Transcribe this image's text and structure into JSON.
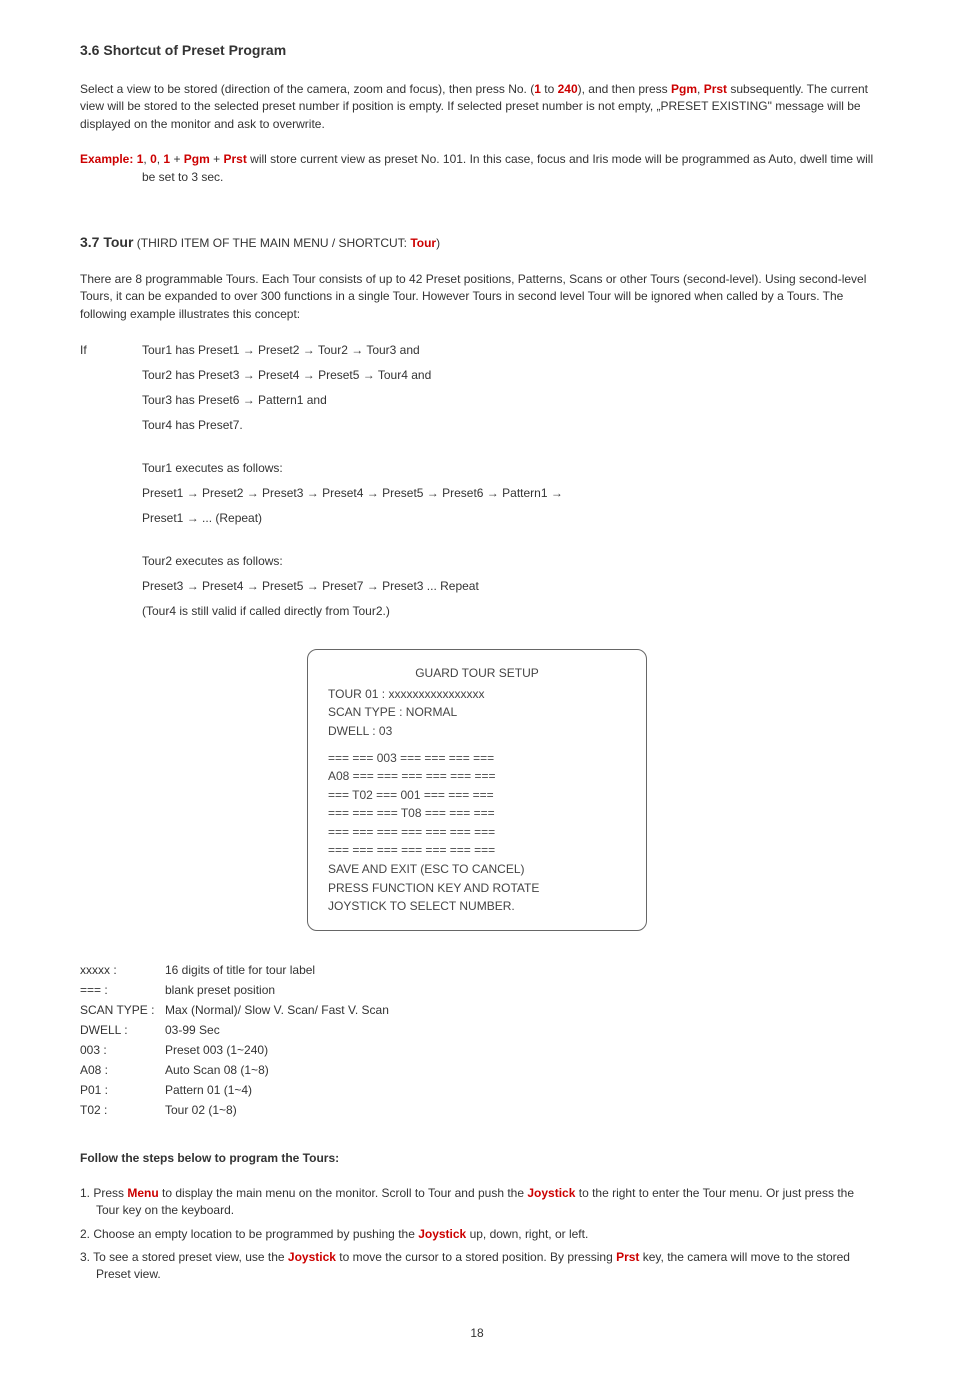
{
  "section36": {
    "heading": "3.6  Shortcut of Preset Program",
    "para1_a": "Select a view to be stored (direction of the camera, zoom and focus), then press No. (",
    "para1_b": " to ",
    "para1_c": "), and then press ",
    "para1_d": ", ",
    "para1_e": " subsequently. The current view will be stored to the selected preset number if position is empty. If selected preset number is not empty, „PRESET EXISTING\" message will be displayed on the monitor and ask to overwrite.",
    "no1": "1",
    "no240": "240",
    "pgm": "Pgm",
    "prst": "Prst",
    "example_label": "Example: ",
    "ex_1": "1",
    "ex_comma1": ", ",
    "ex_0": "0",
    "ex_comma2": ", ",
    "ex_1b": "1",
    "ex_plus1": " + ",
    "ex_pgm": "Pgm",
    "ex_plus2": " + ",
    "ex_prst": "Prst",
    "example_rest": " will store current view as preset No. 101. In this case, focus and Iris mode will be programmed as Auto, dwell time will be set to 3 sec."
  },
  "section37": {
    "heading_main": "3.7  Tour",
    "heading_sub_a": "  (THIRD ITEM OF THE MAIN MENU / SHORTCUT: ",
    "heading_sub_tour": "Tour",
    "heading_sub_b": ")",
    "para1": "There are 8 programmable Tours. Each Tour consists of up to 42 Preset positions, Patterns, Scans or other Tours (second-level). Using second-level Tours, it can be expanded to over 300 functions in a single Tour. However Tours in second level Tour will be ignored when called by a Tours. The following example illustrates this concept:",
    "if_label": "If",
    "if_lines": [
      "Tour1 has Preset1 → Preset2 → Tour2 → Tour3 and",
      "Tour2 has Preset3 → Preset4 → Preset5 → Tour4 and",
      "Tour3 has Preset6 → Pattern1 and",
      "Tour4 has Preset7."
    ],
    "exec1_lines": [
      "Tour1 executes as follows:",
      "Preset1 → Preset2 → Preset3 → Preset4 → Preset5 → Preset6 → Pattern1 →",
      "Preset1 → ... (Repeat)"
    ],
    "exec2_lines": [
      " Tour2 executes as follows:",
      "Preset3 → Preset4 → Preset5 → Preset7 → Preset3 ... Repeat",
      "(Tour4 is still valid if called directly from Tour2.)"
    ]
  },
  "screenbox": {
    "title": "GUARD TOUR SETUP",
    "l1": "TOUR 01       : xxxxxxxxxxxxxxxx",
    "l2": "SCAN TYPE  : NORMAL",
    "l3": "DWELL         : 03",
    "l4": "=== === 003 === === === ===",
    "l5": "A08 === === === === === ===",
    "l6": "=== T02 === 001 === === ===",
    "l7": "=== === === T08 === === ===",
    "l8": "=== === === === === === ===",
    "l9": "=== === === === === === ===",
    "l10": "SAVE AND EXIT (ESC TO CANCEL)",
    "l11": "PRESS FUNCTION KEY AND ROTATE",
    "l12": "JOYSTICK TO SELECT NUMBER."
  },
  "defs": [
    {
      "label": "xxxxx :",
      "val": "16 digits of title for tour label"
    },
    {
      "label": "=== :",
      "val": "blank preset position"
    },
    {
      "label": "SCAN TYPE :",
      "val": "Max (Normal)/ Slow V. Scan/ Fast V. Scan"
    },
    {
      "label": "DWELL :",
      "val": "03-99 Sec"
    },
    {
      "label": "003 :",
      "val": "Preset 003 (1~240)"
    },
    {
      "label": "A08 :",
      "val": "Auto Scan 08 (1~8)"
    },
    {
      "label": "P01 :",
      "val": "Pattern 01 (1~4)"
    },
    {
      "label": "T02 :",
      "val": "Tour 02     (1~8)"
    }
  ],
  "follow": {
    "heading": "Follow the steps below to program the Tours:",
    "step1_a": "1.  Press ",
    "step1_menu": "Menu",
    "step1_b": " to display the main menu on the monitor. Scroll to Tour and push the ",
    "step1_joy": "Joystick",
    "step1_c": " to the right to enter the Tour menu. Or just press the Tour key on the keyboard.",
    "step2_a": "2.  Choose an empty location to be programmed by pushing the ",
    "step2_joy": "Joystick",
    "step2_b": " up, down, right, or left.",
    "step3_a": "3.  To see a stored preset view, use the ",
    "step3_joy": "Joystick",
    "step3_b": " to move the cursor to a stored position. By pressing ",
    "step3_prst": "Prst",
    "step3_c": " key, the camera will move to the stored Preset view."
  },
  "pagenum": "18"
}
